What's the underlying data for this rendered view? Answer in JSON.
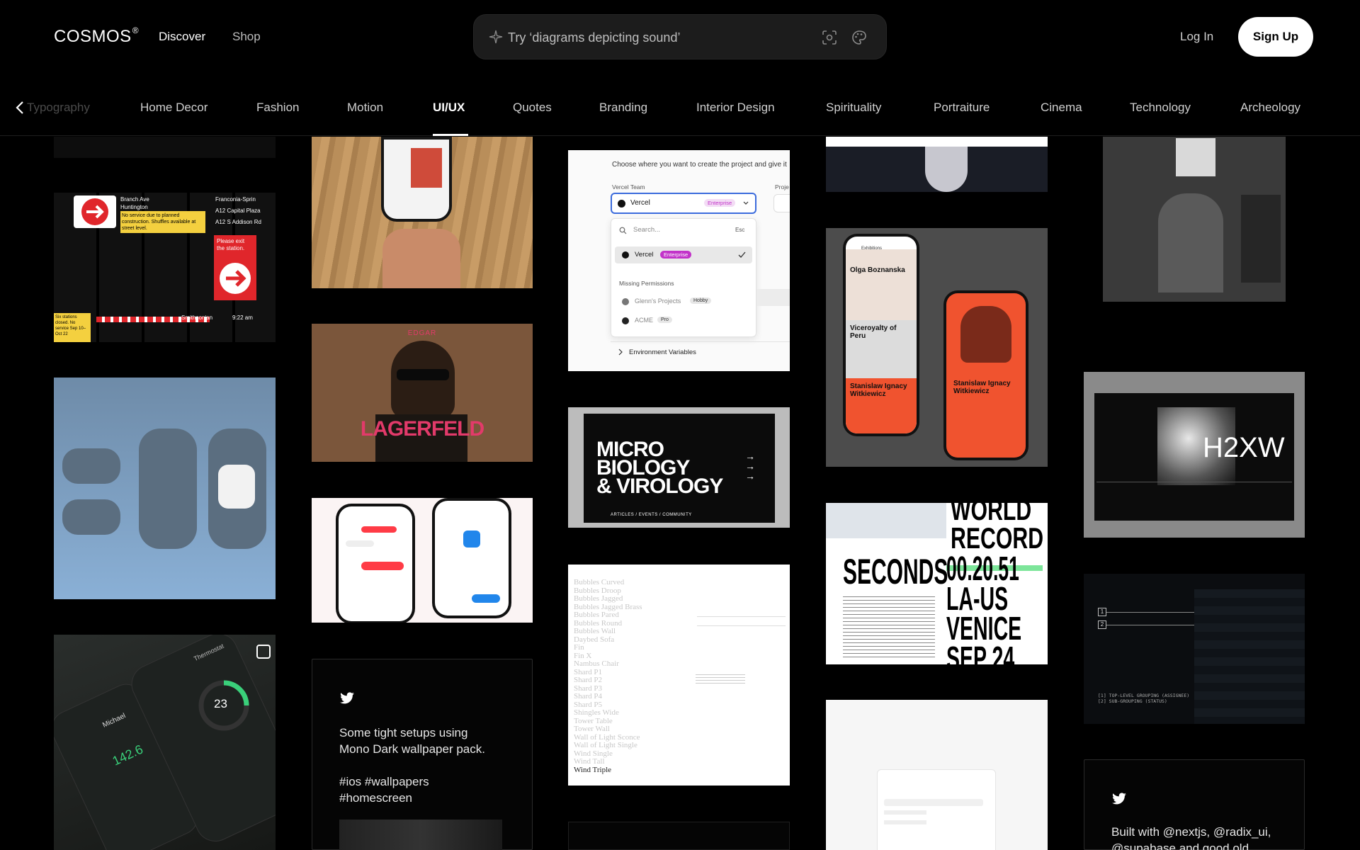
{
  "header": {
    "logo": "COSMOS",
    "logo_mark": "®",
    "nav": {
      "discover": "Discover",
      "shop": "Shop"
    },
    "search_placeholder": "Try ‘diagrams depicting sound’",
    "login": "Log In",
    "signup": "Sign Up"
  },
  "categories": {
    "faded": "Typography",
    "items": [
      "Home Decor",
      "Fashion",
      "Motion",
      "UI/UX",
      "Quotes",
      "Branding",
      "Interior Design",
      "Spirituality",
      "Portraiture",
      "Cinema",
      "Technology",
      "Archeology"
    ],
    "active": "UI/UX"
  },
  "tiles": {
    "transit": {
      "streets": [
        "Branch Ave",
        "Huntington"
      ],
      "notice": "No service due to planned construction. Shuffles available at street level.",
      "routes": [
        "Franconia-Sprin",
        "A12 Capital Plaza",
        "A12 S Addison Rd"
      ],
      "exit": "Please exit the station.",
      "closed": "Six stations closed. No service Sep 10–Oct 22",
      "stop": "Smithsonian",
      "time": "9:22 am"
    },
    "lagerfeld": {
      "kicker": "EDGAR",
      "title": "LAGERFELD"
    },
    "vercel": {
      "heading": "Choose where you want to create the project and give it",
      "team_label": "Vercel Team",
      "project_label": "Proje",
      "team": "Vercel",
      "badge_enterprise": "Enterprise",
      "search": "Search...",
      "esc": "Esc",
      "missing": "Missing Permissions",
      "glenn": "Glenn's Projects",
      "badge_hobby": "Hobby",
      "acme": "ACME",
      "badge_pro": "Pro",
      "env": "Environment Variables"
    },
    "micro": {
      "line1": "MICRO",
      "line2": "BIOLOGY",
      "line3": "& VIROLOGY",
      "footer": "ARTICLES / EVENTS / COMMUNITY"
    },
    "exhibitions": {
      "title": "Exhibitions",
      "items": [
        "Olga Boznanska",
        "Viceroyalty of Peru",
        "Stanislaw Ignacy Witkiewicz"
      ],
      "right_title": "Stanislaw Ignacy Witkiewicz"
    },
    "record": {
      "line1": "WORLD",
      "line2": "RECORD",
      "seconds": "SECONDS",
      "time": "00.20.51",
      "place": "LA-US",
      "venice": "VENICE",
      "date": "SEP 24"
    },
    "h2xw": {
      "title": "H2XW"
    },
    "thermostat": {
      "label": "Thermostat",
      "temp": "23",
      "energy": "142.6",
      "user": "Michael"
    },
    "linear": {
      "top_level": "TOP-LEVEL GROUPING (ASSIGNEE)",
      "sub": "SUB-GROUPING (STATUS)"
    },
    "twitter1": {
      "line1": "Some tight setups using",
      "line2": "Mono Dark wallpaper pack.",
      "line3": "#ios #wallpapers",
      "line4": "#homescreen"
    },
    "twitter2": {
      "line1": "Built with @nextjs, @radix_ui,",
      "line2": "@supabase and good old"
    },
    "fonts_list": [
      "Bubbles Curved",
      "Bubbles Droop",
      "Bubbles Jagged",
      "Bubbles Jagged Brass",
      "Bubbles Pared",
      "Bubbles Round",
      "Bubbles Wall",
      "Daybed Sofa",
      "Fin",
      "Fin X",
      "Nambus Chair",
      "Shard P1",
      "Shard P2",
      "Shard P3",
      "Shard P4",
      "Shard P5",
      "Shingles Wide",
      "Tower Table",
      "Tower Wall",
      "Wall of Light Sconce",
      "Wall of Light Single",
      "Wind Single",
      "Wind Tall",
      "Wind Triple"
    ]
  }
}
